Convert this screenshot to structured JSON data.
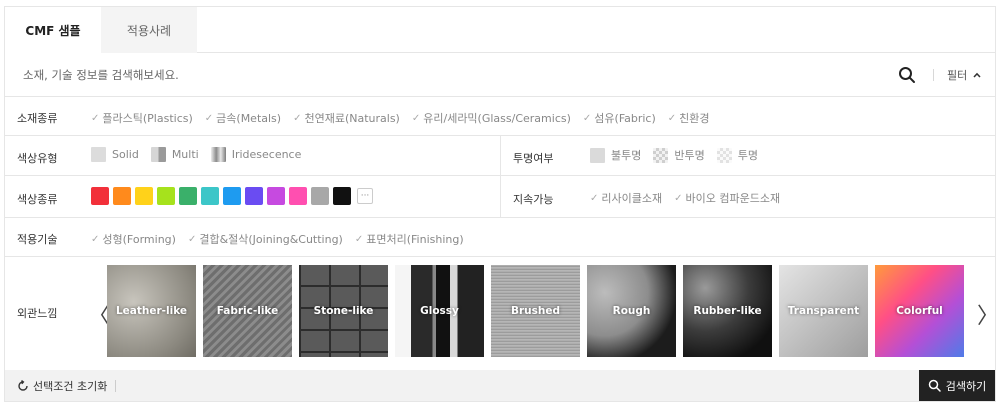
{
  "tabs": [
    {
      "label": "CMF 샘플",
      "active": true
    },
    {
      "label": "적용사례",
      "active": false
    }
  ],
  "search": {
    "placeholder": "소재, 기술 정보를 검색해보세요.",
    "filter_label": "필터",
    "icon": "search-icon"
  },
  "material": {
    "label": "소재종류",
    "options": [
      "플라스틱(Plastics)",
      "금속(Metals)",
      "천연재료(Naturals)",
      "유리/세라믹(Glass/Ceramics)",
      "섬유(Fabric)",
      "친환경"
    ]
  },
  "color_type": {
    "label": "색상유형",
    "options": [
      "Solid",
      "Multi",
      "Iridesecence"
    ]
  },
  "transparency": {
    "label": "투명여부",
    "options": [
      "불투명",
      "반투명",
      "투명"
    ]
  },
  "color_kind": {
    "label": "색상종류",
    "colors": [
      "#f2303a",
      "#ff8a1c",
      "#ffd21a",
      "#a6e21c",
      "#3ab06a",
      "#3cc6c8",
      "#1e9bf0",
      "#6a4cf2",
      "#c64ae0",
      "#ff4fb0",
      "#a8a8a8",
      "#111111"
    ],
    "more": "···"
  },
  "sustainability": {
    "label": "지속가능",
    "options": [
      "리사이클소재",
      "바이오 컴파운드소재"
    ]
  },
  "tech": {
    "label": "적용기술",
    "options": [
      "성형(Forming)",
      "결합&절삭(Joining&Cutting)",
      "표면처리(Finishing)"
    ]
  },
  "appearance": {
    "label": "외관느낌",
    "prev": "〈",
    "next": "〉",
    "items": [
      "Leather-like",
      "Fabric-like",
      "Stone-like",
      "Glossy",
      "Brushed",
      "Rough",
      "Rubber-like",
      "Transparent",
      "Colorful"
    ]
  },
  "bottom": {
    "reset_label": "선택조건 초기화",
    "submit_label": "검색하기"
  }
}
